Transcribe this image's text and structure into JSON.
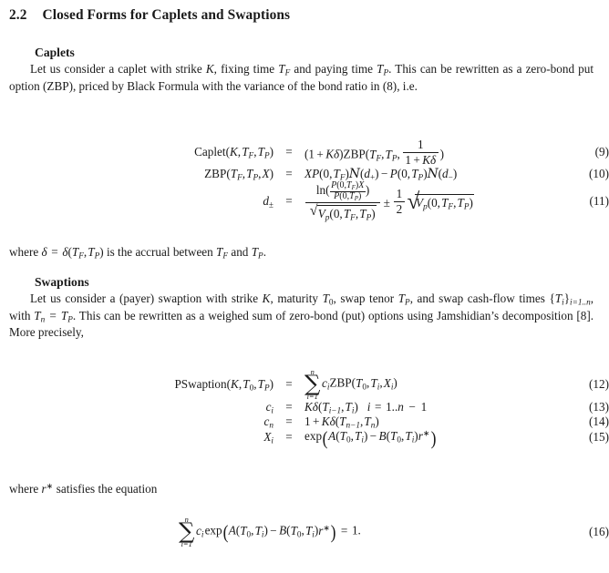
{
  "document": {
    "section": {
      "number": "2.2",
      "title": "Closed Forms for Caplets and Swaptions"
    },
    "caplets": {
      "heading": "Caplets",
      "paragraph_parts": {
        "p1a": "Let us consider a caplet with strike ",
        "K": "K",
        "p1b": ", fixing time ",
        "TF": "T",
        "TF_sub": "F",
        "p1c": " and paying time ",
        "TP": "T",
        "TP_sub": "P",
        "p1d": ". This can be rewritten as a zero-bond put option (ZBP), priced by Black Formula with the variance of the bond ratio in (8), i.e."
      },
      "full_paragraph": "Let us consider a caplet with strike K, fixing time TF and paying time TP. This can be rewritten as a zero-bond put option (ZBP), priced by Black Formula with the variance of the bond ratio in (8), i.e."
    },
    "where_delta": {
      "prefix": "where ",
      "delta": "δ",
      "eq": "=",
      "deltafn": "δ",
      "args": "(T_F, T_P)",
      "suffix": "is the accrual between",
      "tail": "and",
      "period": ".",
      "full": "where δ = δ(TF, TP) is the accrual between TF and TP."
    },
    "swaptions": {
      "heading": "Swaptions",
      "full_paragraph": "Let us consider a (payer) swaption with strike K, maturity T0, swap tenor TP, and swap cash-flow times {Ti}i=1..n, with Tn = TP. This can be rewritten as a weighed sum of zero-bond (put) options using Jamshidian's decomposition [8]. More precisely,",
      "parts": {
        "a": "Let us consider a (payer) swaption with strike ",
        "K": "K",
        "b": ", maturity ",
        "T0": "T",
        "T0sub": "0",
        "c": ", swap tenor ",
        "TP": "T",
        "TPsub": "P",
        "d": ", and swap cash-flow times ",
        "setopen": "{",
        "Ti": "T",
        "Tisub": "i",
        "setclose": "}",
        "setsub": "i=1..n",
        "e": ", with ",
        "Tn": "T",
        "Tnsub": "n",
        "f": " = ",
        "g": ". This can be rewritten as a weighed sum of zero-bond (put) options using Jamshidian's decomposition [8]. More precisely,"
      }
    },
    "where_rstar": {
      "full": "where r* satisfies the equation",
      "prefix": "where ",
      "r": "r",
      "star": "∗",
      "suffix": " satisfies the equation"
    }
  },
  "equations": [
    {
      "tag": "(9)",
      "lhs_plain": "Caplet(K, T_F, T_P)",
      "rel": "=",
      "rhs_plain": "(1 + Kδ)ZBP(T_F, T_P, 1/(1+Kδ))"
    },
    {
      "tag": "(10)",
      "lhs_plain": "ZBP(T_F, T_P, X)",
      "rel": "=",
      "rhs_plain": "X P(0,T_F) N(d_+) − P(0,T_P) N(d_−)"
    },
    {
      "tag": "(11)",
      "lhs_plain": "d_±",
      "rel": "=",
      "rhs_plain": "ln(P(0,T_F)X / P(0,T_P)) / sqrt(V_p(0,T_F,T_P)) ± (1/2) sqrt(V_p(0,T_F,T_P))"
    },
    {
      "tag": "(12)",
      "lhs_plain": "PSwaption(K, T_0, T_P)",
      "rel": "=",
      "rhs_plain": "sum_{i=1}^{n} c_i ZBP(T_0, T_i, X_i)"
    },
    {
      "tag": "(13)",
      "lhs_plain": "c_i",
      "rel": "=",
      "rhs_plain": "Kδ(T_{i−1}, T_i)   i = 1..n − 1"
    },
    {
      "tag": "(14)",
      "lhs_plain": "c_n",
      "rel": "=",
      "rhs_plain": "1 + Kδ(T_{n−1}, T_n)"
    },
    {
      "tag": "(15)",
      "lhs_plain": "X_i",
      "rel": "=",
      "rhs_plain": "exp(A(T_0,T_i) − B(T_0,T_i) r*)"
    },
    {
      "tag": "(16)",
      "lhs_plain": "",
      "rel": "",
      "rhs_plain": "sum_{i=1}^{n} c_i exp(A(T_0,T_i) − B(T_0,T_i) r*) = 1."
    }
  ],
  "symbols": {
    "sum": "∑",
    "sqrt": "√",
    "pm": "±",
    "minus": "−",
    "plus": "+",
    "equals": "=",
    "delta": "δ",
    "scriptN": "𝒩",
    "star": "∗",
    "lparen_big": "(",
    "rparen_big": ")"
  },
  "tags": {
    "e9": "(9)",
    "e10": "(10)",
    "e11": "(11)",
    "e12": "(12)",
    "e13": "(13)",
    "e14": "(14)",
    "e15": "(15)",
    "e16": "(16)"
  },
  "colors": {
    "page_background": "#ffffff",
    "text": "#1a1a1a"
  }
}
